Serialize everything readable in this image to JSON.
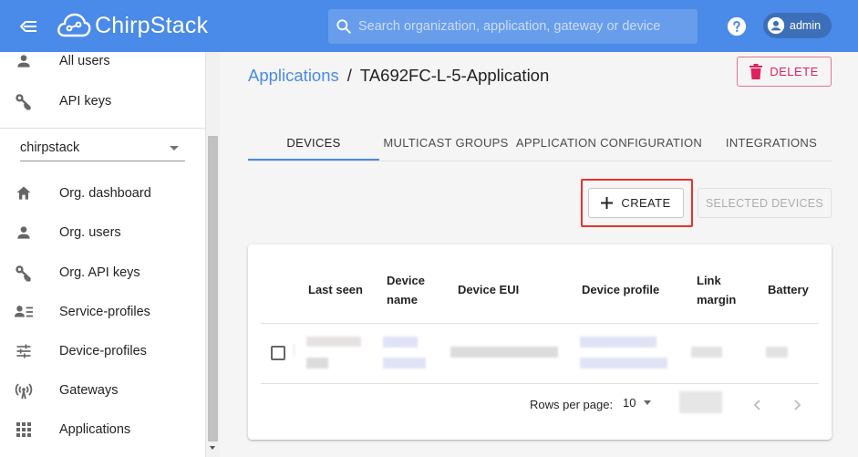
{
  "app": {
    "name": "ChirpStack"
  },
  "search": {
    "placeholder": "Search organization, application, gateway or device"
  },
  "user": {
    "name": "admin"
  },
  "sidebar": {
    "top_items": [
      {
        "label": "All users",
        "icon": "person-icon"
      },
      {
        "label": "API keys",
        "icon": "key-icon"
      }
    ],
    "organization": "chirpstack",
    "org_items": [
      {
        "label": "Org. dashboard",
        "icon": "home-icon"
      },
      {
        "label": "Org. users",
        "icon": "person-icon"
      },
      {
        "label": "Org. API keys",
        "icon": "key-icon"
      },
      {
        "label": "Service-profiles",
        "icon": "service-profile-icon"
      },
      {
        "label": "Device-profiles",
        "icon": "tune-icon"
      },
      {
        "label": "Gateways",
        "icon": "antenna-icon"
      },
      {
        "label": "Applications",
        "icon": "apps-grid-icon"
      }
    ]
  },
  "breadcrumb": {
    "parent": "Applications",
    "separator": "/",
    "current": "TA692FC-L-5-Application"
  },
  "actions": {
    "delete_label": "DELETE",
    "create_label": "CREATE",
    "selected_devices_label": "SELECTED DEVICES"
  },
  "tabs": [
    {
      "label": "DEVICES",
      "active": true
    },
    {
      "label": "MULTICAST GROUPS",
      "active": false
    },
    {
      "label": "APPLICATION CONFIGURATION",
      "active": false
    },
    {
      "label": "INTEGRATIONS",
      "active": false
    }
  ],
  "table": {
    "columns": {
      "last_seen": "Last seen",
      "device_name_1": "Device",
      "device_name_2": "name",
      "device_eui": "Device EUI",
      "device_profile": "Device profile",
      "link_margin_1": "Link",
      "link_margin_2": "margin",
      "battery": "Battery"
    },
    "rows_per_page_label": "Rows per page:",
    "rows_per_page": "10"
  },
  "colors": {
    "primary": "#4a8ae8",
    "delete": "#e0225e",
    "highlight": "#e8322d"
  }
}
